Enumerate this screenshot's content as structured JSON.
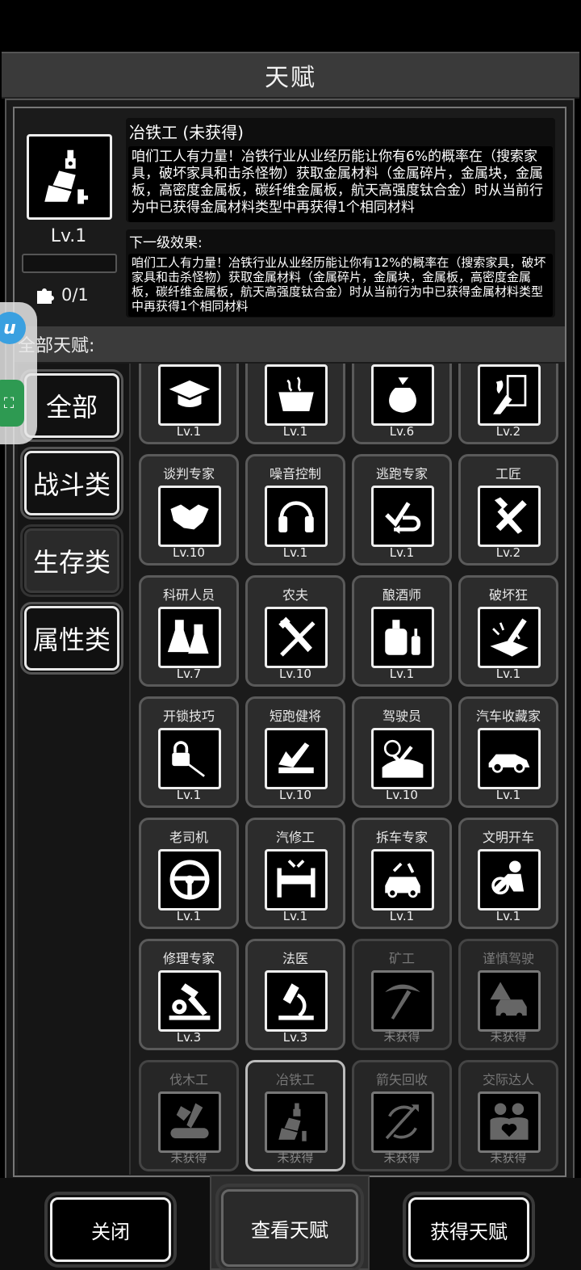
{
  "title": "天赋",
  "selected": {
    "name_line": "冶铁工 (未获得)",
    "description": "咱们工人有力量！冶铁行业从业经历能让你有6%的概率在（搜索家具，破坏家具和击杀怪物）获取金属材料（金属碎片，金属块，金属板，高密度金属板，碳纤维金属板，航天高强度钛合金）时从当前行为中已获得金属材料类型中再获得1个相同材料",
    "level": "Lv.1",
    "pieces": "0/1",
    "next_label": "下一级效果:",
    "next_description": "咱们工人有力量！冶铁行业从业经历能让你有12%的概率在（搜索家具，破坏家具和击杀怪物）获取金属材料（金属碎片，金属块，金属板，高密度金属板，碳纤维金属板，航天高强度钛合金）时从当前行为中已获得金属材料类型中再获得1个相同材料"
  },
  "all_label": "全部天赋:",
  "categories": [
    "全部",
    "战斗类",
    "生存类",
    "属性类"
  ],
  "selected_category": "生存类",
  "talents": [
    {
      "name": "",
      "level": "Lv.1",
      "icon": "graduation-cap-icon",
      "locked": false
    },
    {
      "name": "",
      "level": "Lv.1",
      "icon": "cooking-pot-icon",
      "locked": false
    },
    {
      "name": "",
      "level": "Lv.6",
      "icon": "sack-icon",
      "locked": false
    },
    {
      "name": "",
      "level": "Lv.2",
      "icon": "door-fire-icon",
      "locked": false
    },
    {
      "name": "谈判专家",
      "level": "Lv.10",
      "icon": "handshake-icon",
      "locked": false
    },
    {
      "name": "噪音控制",
      "level": "Lv.1",
      "icon": "headphones-icon",
      "locked": false
    },
    {
      "name": "逃跑专家",
      "level": "Lv.1",
      "icon": "escape-arrow-icon",
      "locked": false
    },
    {
      "name": "工匠",
      "level": "Lv.2",
      "icon": "hammer-saw-icon",
      "locked": false
    },
    {
      "name": "科研人员",
      "level": "Lv.7",
      "icon": "flask-icon",
      "locked": false
    },
    {
      "name": "农夫",
      "level": "Lv.10",
      "icon": "farm-tools-icon",
      "locked": false
    },
    {
      "name": "酿酒师",
      "level": "Lv.1",
      "icon": "brewing-icon",
      "locked": false
    },
    {
      "name": "破坏狂",
      "level": "Lv.1",
      "icon": "smash-icon",
      "locked": false
    },
    {
      "name": "开锁技巧",
      "level": "Lv.1",
      "icon": "lockpick-icon",
      "locked": false
    },
    {
      "name": "短跑健将",
      "level": "Lv.10",
      "icon": "sprint-shoe-icon",
      "locked": false
    },
    {
      "name": "驾驶员",
      "level": "Lv.10",
      "icon": "road-speed-icon",
      "locked": false
    },
    {
      "name": "汽车收藏家",
      "level": "Lv.1",
      "icon": "sports-car-icon",
      "locked": false
    },
    {
      "name": "老司机",
      "level": "Lv.1",
      "icon": "steering-wheel-icon",
      "locked": false
    },
    {
      "name": "汽修工",
      "level": "Lv.1",
      "icon": "car-lift-icon",
      "locked": false
    },
    {
      "name": "拆车专家",
      "level": "Lv.1",
      "icon": "car-repair-icon",
      "locked": false
    },
    {
      "name": "文明开车",
      "level": "Lv.1",
      "icon": "calm-driver-icon",
      "locked": false
    },
    {
      "name": "修理专家",
      "level": "Lv.3",
      "icon": "hammer-gear-icon",
      "locked": false
    },
    {
      "name": "法医",
      "level": "Lv.3",
      "icon": "microscope-icon",
      "locked": false
    },
    {
      "name": "矿工",
      "level": "未获得",
      "icon": "pickaxe-icon",
      "locked": true
    },
    {
      "name": "谨慎驾驶",
      "level": "未获得",
      "icon": "warning-car-icon",
      "locked": true
    },
    {
      "name": "伐木工",
      "level": "未获得",
      "icon": "axe-log-icon",
      "locked": true
    },
    {
      "name": "冶铁工",
      "level": "未获得",
      "icon": "ladle-icon",
      "locked": true,
      "current": true
    },
    {
      "name": "箭矢回收",
      "level": "未获得",
      "icon": "arrow-recycle-icon",
      "locked": true
    },
    {
      "name": "交际达人",
      "level": "未获得",
      "icon": "friends-heart-icon",
      "locked": true
    }
  ],
  "buttons": {
    "close": "关闭",
    "view": "查看天赋",
    "acquire": "获得天赋"
  }
}
